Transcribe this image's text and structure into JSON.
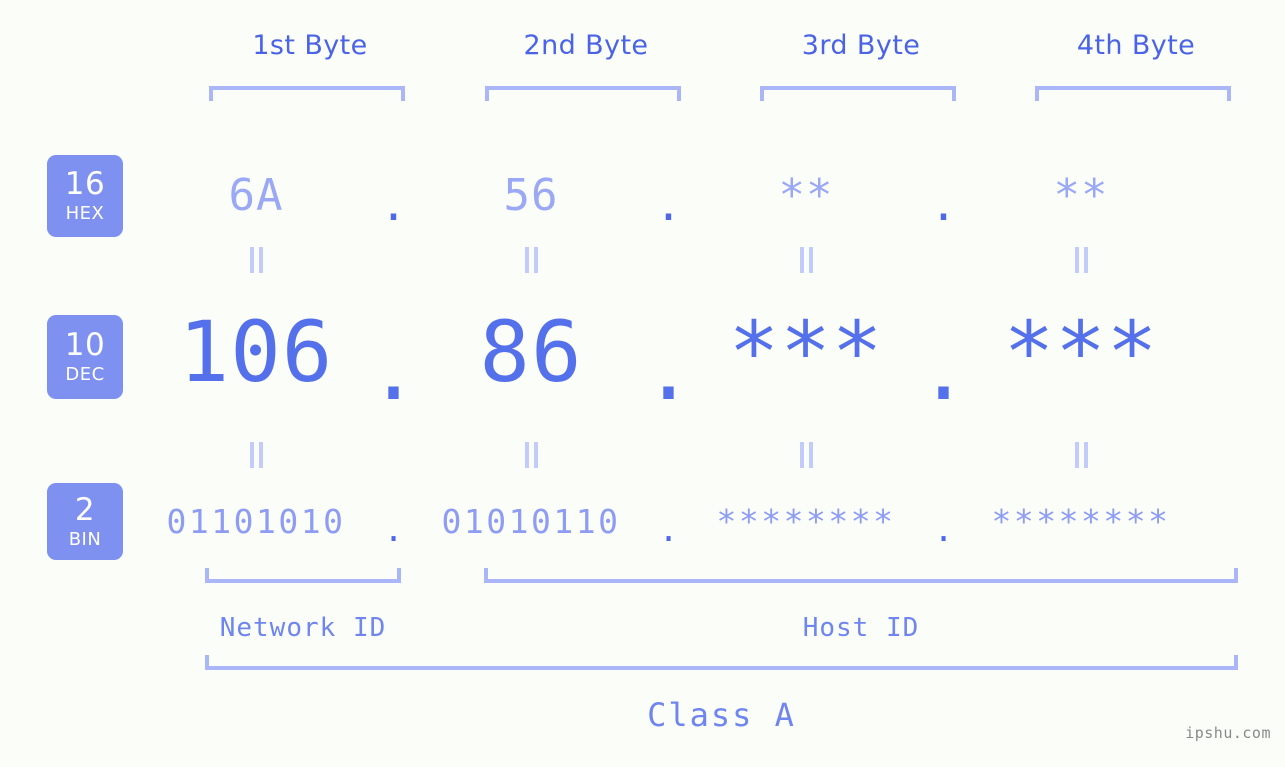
{
  "page": {
    "background_color": "#fbfdf8",
    "accent_color": "#5470ea",
    "accent_light_color": "#9aa8f5",
    "bracket_color": "#aab6f7",
    "badge_color": "#7e90f0",
    "watermark": "ipshu.com"
  },
  "byte_headers": [
    {
      "label": "1st Byte"
    },
    {
      "label": "2nd Byte"
    },
    {
      "label": "3rd Byte"
    },
    {
      "label": "4th Byte"
    }
  ],
  "bases": [
    {
      "number": "16",
      "name": "HEX"
    },
    {
      "number": "10",
      "name": "DEC"
    },
    {
      "number": "2",
      "name": "BIN"
    }
  ],
  "rows": {
    "hex": {
      "base_number": "16",
      "base_name": "HEX",
      "values": [
        "6A",
        "56",
        "**",
        "**"
      ],
      "separator": "."
    },
    "dec": {
      "base_number": "10",
      "base_name": "DEC",
      "values": [
        "106",
        "86",
        "***",
        "***"
      ],
      "separator": "."
    },
    "bin": {
      "base_number": "2",
      "base_name": "BIN",
      "values": [
        "01101010",
        "01010110",
        "********",
        "********"
      ],
      "separator": "."
    }
  },
  "equals_symbol": "=",
  "segments": {
    "network_id": "Network ID",
    "host_id": "Host ID",
    "class": "Class A"
  }
}
